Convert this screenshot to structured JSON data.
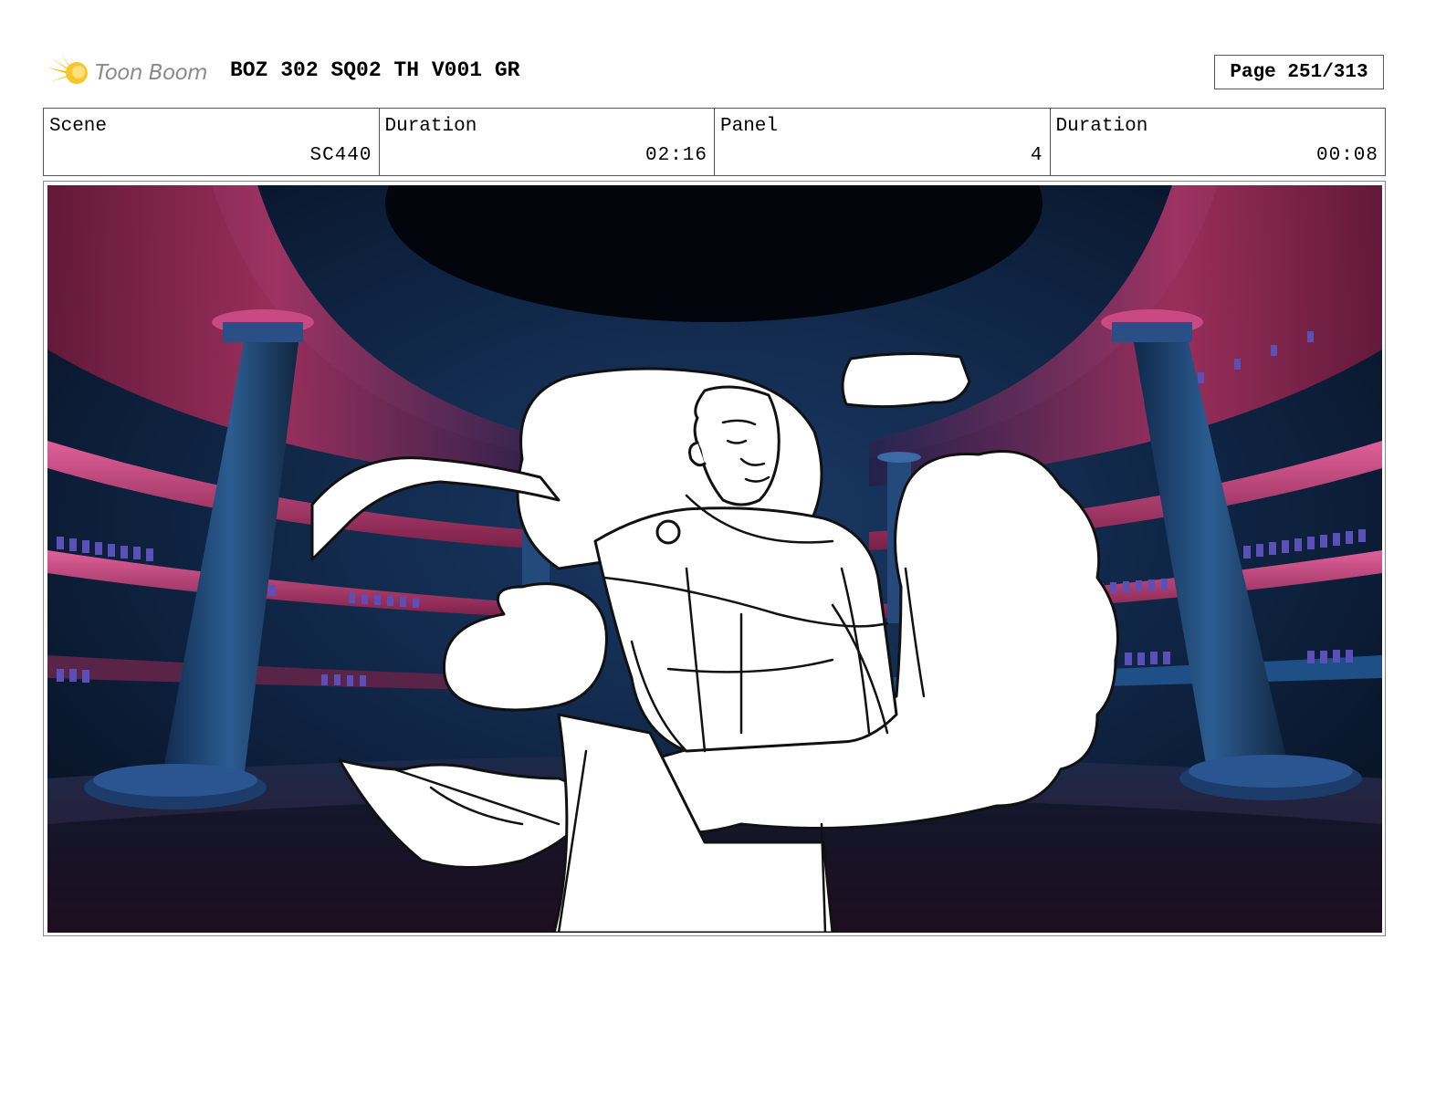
{
  "header": {
    "logo_text": "Toon Boom",
    "title": "BOZ 302 SQ02 TH V001 GR",
    "page_label": "Page 251/313"
  },
  "info": {
    "scene_label": "Scene",
    "scene_value": "SC440",
    "duration_label": "Duration",
    "duration_value": "02:16",
    "panel_label": "Panel",
    "panel_value": "4",
    "panel_duration_label": "Duration",
    "panel_duration_value": "00:08"
  },
  "panel": {
    "icon": "storyboard-panel-image"
  },
  "colors": {
    "logo_flare": "#f5b800",
    "logo_text": "#8a8a8a",
    "wall_pink": "#c0396a",
    "wall_blue": "#1d4e80",
    "dark": "#06101e"
  }
}
